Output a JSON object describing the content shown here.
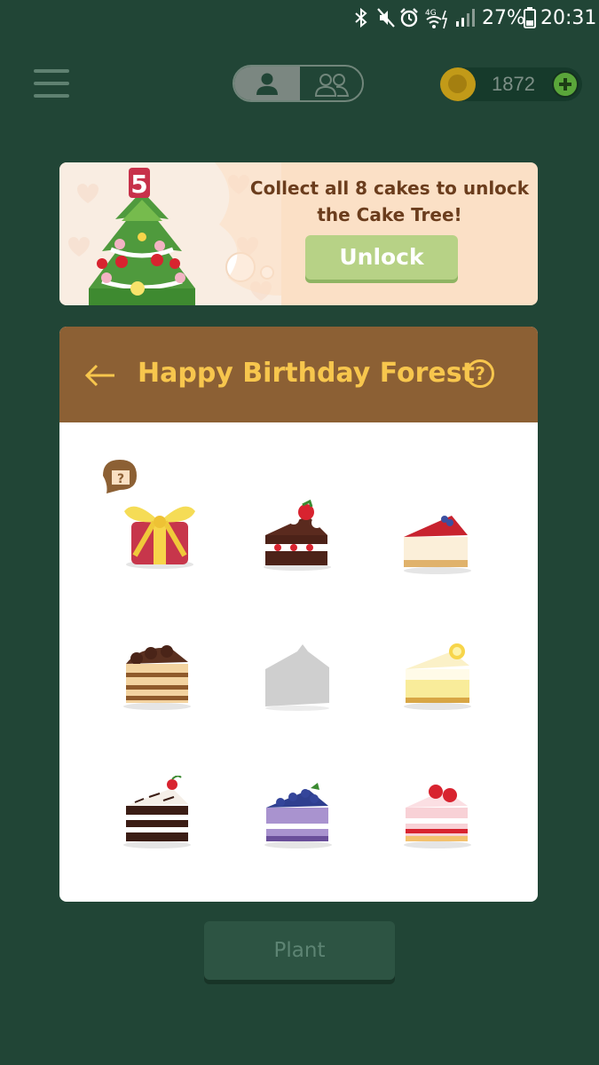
{
  "status_bar": {
    "icons": [
      "bluetooth-icon",
      "mute-icon",
      "alarm-icon",
      "wifi-4g-icon",
      "signal-icon",
      "battery-icon"
    ],
    "battery_percent": "27%",
    "time": "20:31"
  },
  "top_bar": {
    "modes": [
      "solo",
      "group"
    ],
    "selected_mode": "solo",
    "coins": "1872"
  },
  "banner": {
    "message": "Collect all 8 cakes to unlock the Cake Tree!",
    "unlock_label": "Unlock",
    "tree_number": "5"
  },
  "panel": {
    "title": "Happy Birthday Forest",
    "help_symbol": "?",
    "items": [
      {
        "name": "mystery gift box",
        "state": "unlocked"
      },
      {
        "name": "chocolate strawberry cake",
        "state": "unlocked"
      },
      {
        "name": "berry cheesecake",
        "state": "unlocked"
      },
      {
        "name": "tiramisu",
        "state": "unlocked"
      },
      {
        "name": "strawberry cake",
        "state": "locked"
      },
      {
        "name": "lemon cheesecake",
        "state": "unlocked"
      },
      {
        "name": "black forest cake",
        "state": "unlocked"
      },
      {
        "name": "blueberry cake",
        "state": "unlocked"
      },
      {
        "name": "strawberry shortcake",
        "state": "unlocked"
      }
    ],
    "gift_badge": "?"
  },
  "plant_label": "Plant",
  "colors": {
    "background": "#214536",
    "header_brown": "#8c6034",
    "title_gold": "#f7c64d",
    "unlock_green": "#b7d286"
  }
}
